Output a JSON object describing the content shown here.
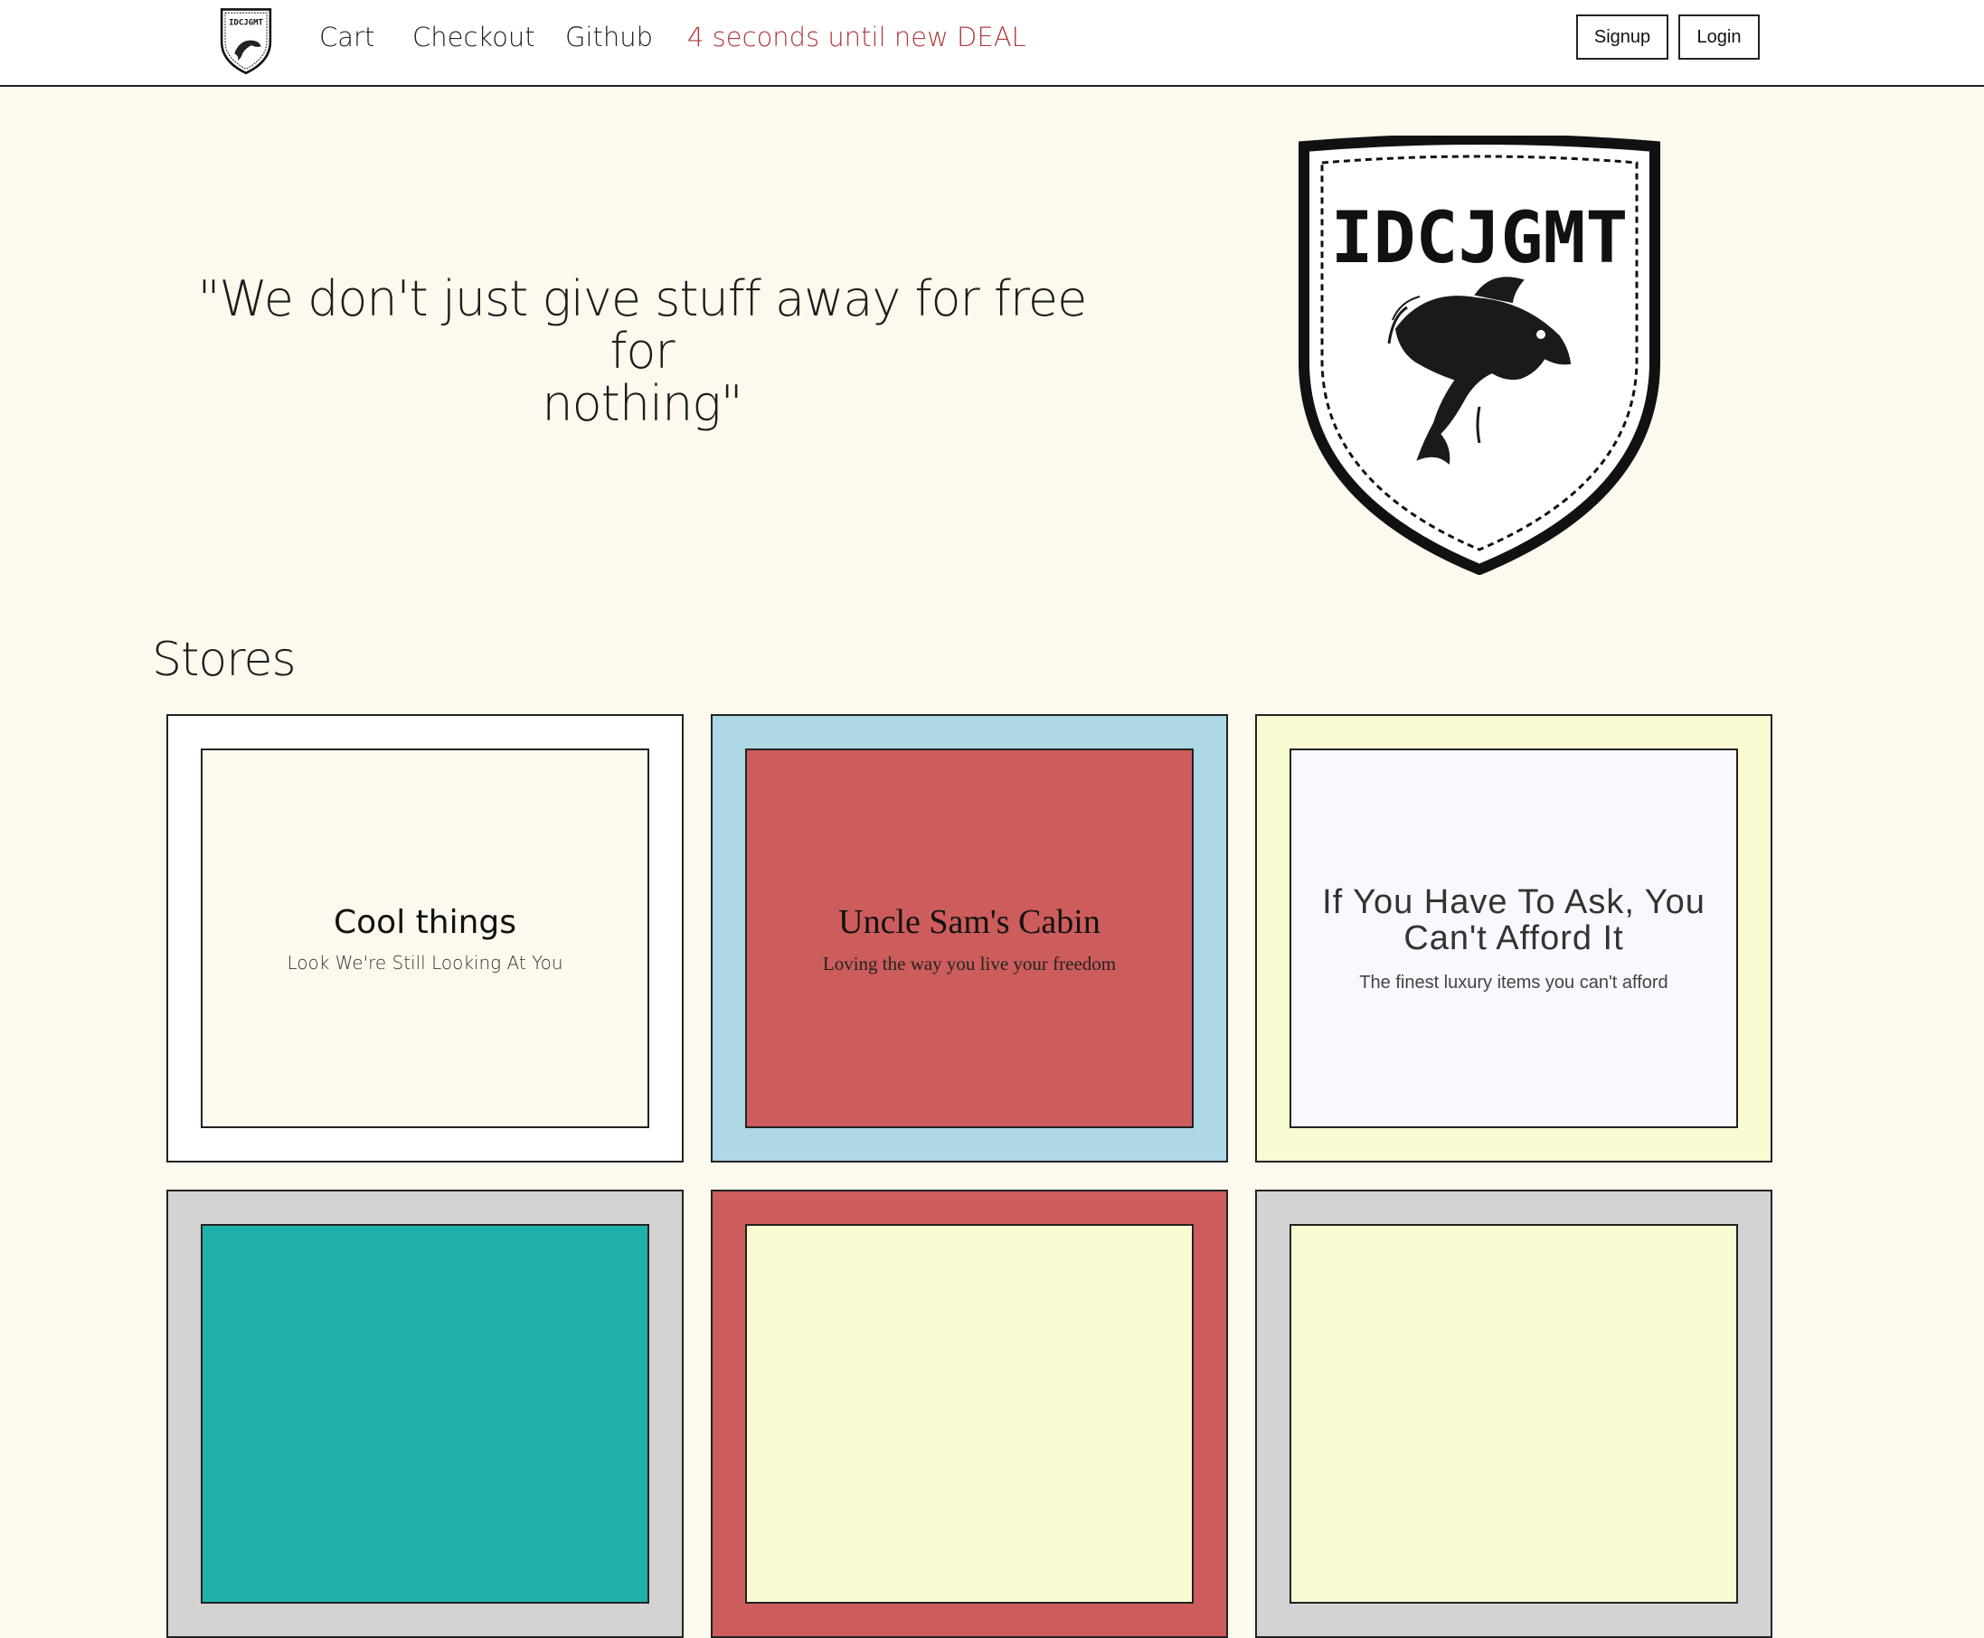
{
  "nav": {
    "logo_text": "IDCJGMT",
    "links": [
      "Cart",
      "Checkout",
      "Github"
    ],
    "deal_countdown": "4 seconds until new DEAL",
    "signup_label": "Signup",
    "login_label": "Login"
  },
  "hero": {
    "quote_line1": "\"We don't just give stuff away for free for",
    "quote_line2": "nothing\"",
    "logo_text": "IDCJGMT"
  },
  "stores": {
    "heading": "Stores",
    "items": [
      {
        "title": "Cool things",
        "subtitle": "Look We're Still Looking At You",
        "outer_color": "#ffffff",
        "inner_color": "#fdf9ee"
      },
      {
        "title": "Uncle Sam's Cabin",
        "subtitle": "Loving the way you live your freedom",
        "outer_color": "#add8e6",
        "inner_color": "#cd5c5c"
      },
      {
        "title": "If You Have To Ask, You Can't Afford It",
        "subtitle": "The finest luxury items you can't afford",
        "outer_color": "#fafad2",
        "inner_color": "#f8f8ff"
      },
      {
        "title": "",
        "subtitle": "",
        "outer_color": "#d3d3d3",
        "inner_color": "#20b2aa"
      },
      {
        "title": "",
        "subtitle": "",
        "outer_color": "#cd5c5c",
        "inner_color": "#fafad2"
      },
      {
        "title": "",
        "subtitle": "",
        "outer_color": "#d3d3d3",
        "inner_color": "#fafad2"
      }
    ]
  }
}
